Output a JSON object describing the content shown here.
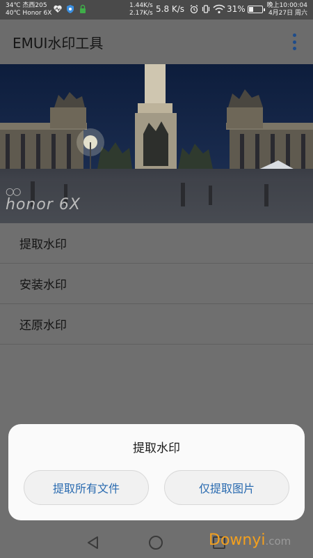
{
  "status_bar": {
    "weather_line1": "34℃ 杰西205",
    "weather_line2": "40℃ Honor 6X",
    "upload_speed": "1.44K/s",
    "download_speed": "2.17K/s",
    "net_speed": "5.8 K/s",
    "battery": "31%",
    "time": "晚上10:00:04",
    "date": "4月27日 周六",
    "icons": [
      "health-icon",
      "shield-icon",
      "lock-icon",
      "alarm-icon",
      "vibrate-icon",
      "wifi-icon",
      "battery-icon"
    ]
  },
  "app_bar": {
    "title": "EMUI水印工具",
    "overflow_icon": "more-vert-icon",
    "accent": "#1e4c8a"
  },
  "banner": {
    "brand_text": "honor 6X",
    "brand_rings": "○○"
  },
  "menu": {
    "items": [
      {
        "label": "提取水印"
      },
      {
        "label": "安装水印"
      },
      {
        "label": "还原水印"
      }
    ]
  },
  "dialog": {
    "title": "提取水印",
    "btn_all": "提取所有文件",
    "btn_images": "仅提取图片",
    "button_color": "#2a6bb0"
  },
  "nav": {
    "back_icon": "back-triangle-icon",
    "home_icon": "home-circle-icon",
    "recent_icon": "recent-square-icon"
  },
  "watermark": {
    "text_main": "Downyi",
    "text_suffix": ".com"
  }
}
